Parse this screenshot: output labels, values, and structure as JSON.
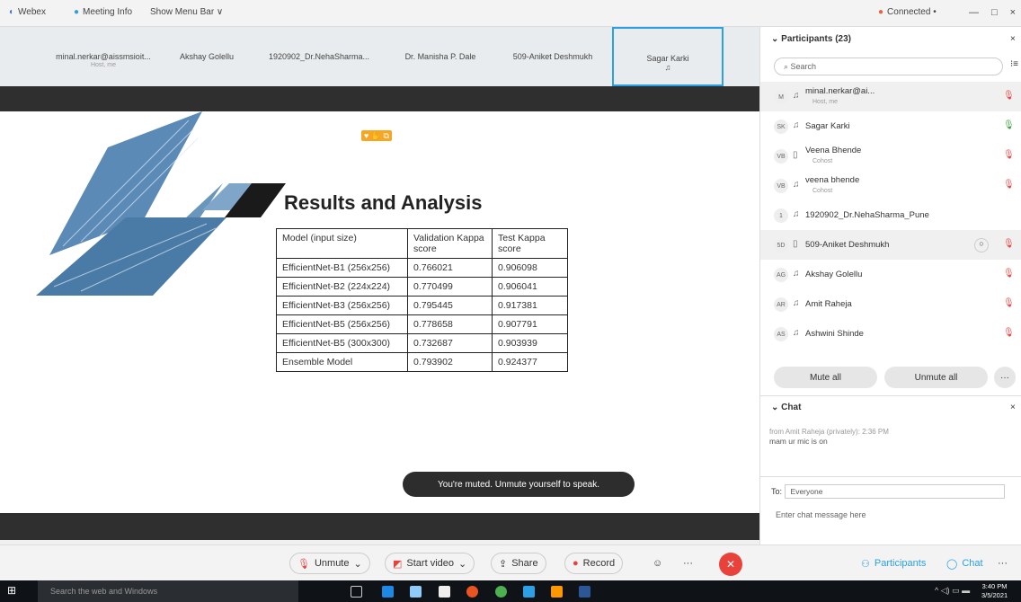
{
  "topbar": {
    "app": "Webex",
    "meeting_info": "Meeting Info",
    "menu_bar": "Show Menu Bar ∨",
    "connected": "Connected •",
    "controls": [
      "—",
      "□",
      "×"
    ]
  },
  "strip": [
    {
      "name": "minal.nerkar@aissmsioit...",
      "sub": "Host, me"
    },
    {
      "name": "Akshay Golellu",
      "sub": ""
    },
    {
      "name": "1920902_Dr.NehaSharma...",
      "sub": ""
    },
    {
      "name": "Dr. Manisha P. Dale",
      "sub": ""
    },
    {
      "name": "509-Aniket Deshmukh",
      "sub": ""
    },
    {
      "name": "Sagar Karki",
      "sub": ""
    }
  ],
  "slide": {
    "title": "Results and Analysis",
    "headers": [
      "Model (input size)",
      "Validation Kappa score",
      "Test Kappa score"
    ],
    "rows": [
      [
        "EfficientNet-B1 (256x256)",
        "0.766021",
        "0.906098"
      ],
      [
        "EfficientNet-B2 (224x224)",
        "0.770499",
        "0.906041"
      ],
      [
        "EfficientNet-B3 (256x256)",
        "0.795445",
        "0.917381"
      ],
      [
        "EfficientNet-B5 (256x256)",
        "0.778658",
        "0.907791"
      ],
      [
        "EfficientNet-B5 (300x300)",
        "0.732687",
        "0.903939"
      ],
      [
        "Ensemble Model",
        "0.793902",
        "0.924377"
      ]
    ]
  },
  "toast": "You're muted. Unmute yourself to speak.",
  "bottombar": {
    "unmute": "Unmute",
    "start_video": "Start video",
    "share": "Share",
    "record": "Record",
    "participants": "Participants",
    "chat": "Chat",
    "more": "···"
  },
  "panel": {
    "title": "Participants (23)",
    "search_placeholder": "Search",
    "participants": [
      {
        "initials": "M",
        "name": "minal.nerkar@ai...",
        "role": "Host, me",
        "mic": "off"
      },
      {
        "initials": "SK",
        "name": "Sagar Karki",
        "role": "",
        "mic": "on"
      },
      {
        "initials": "VB",
        "name": "Veena Bhende",
        "role": "Cohost",
        "mic": "off"
      },
      {
        "initials": "VB",
        "name": "veena bhende",
        "role": "Cohost",
        "mic": "off"
      },
      {
        "initials": "1",
        "name": "1920902_Dr.NehaSharma_Pune",
        "role": "",
        "mic": "none"
      },
      {
        "initials": "5D",
        "name": "509-Aniket Deshmukh",
        "role": "",
        "mic": "off"
      },
      {
        "initials": "AG",
        "name": "Akshay Golellu",
        "role": "",
        "mic": "off"
      },
      {
        "initials": "AR",
        "name": "Amit Raheja",
        "role": "",
        "mic": "off"
      },
      {
        "initials": "AS",
        "name": "Ashwini Shinde",
        "role": "",
        "mic": "off"
      }
    ],
    "mute_all": "Mute all",
    "unmute_all": "Unmute all",
    "chat_title": "Chat",
    "chat_from": "from Amit Raheja (privately):  2:36 PM",
    "chat_msg": "mam ur mic is on",
    "to_label": "To:",
    "to_value": "Everyone",
    "chat_placeholder": "Enter chat message here"
  },
  "taskbar": {
    "search": "Search the web and Windows",
    "time": "3:40 PM",
    "date": "3/5/2021"
  }
}
